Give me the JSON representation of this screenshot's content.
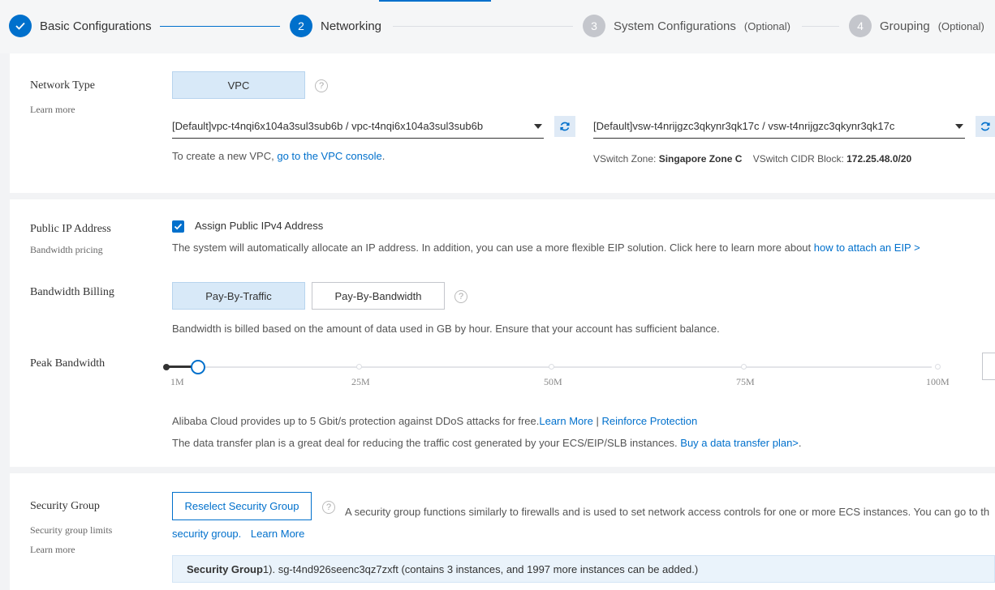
{
  "steps": [
    {
      "title": "Basic Configurations",
      "status": "done",
      "optional": ""
    },
    {
      "number": "2",
      "title": "Networking",
      "status": "active",
      "optional": ""
    },
    {
      "number": "3",
      "title": "System Configurations",
      "status": "todo",
      "optional": "(Optional)"
    },
    {
      "number": "4",
      "title": "Grouping",
      "status": "todo",
      "optional": "(Optional)"
    }
  ],
  "network": {
    "label": "Network Type",
    "learn_more": "Learn more",
    "type_button": "VPC",
    "vpc_value": "[Default]vpc-t4nqi6x104a3sul3sub6b / vpc-t4nqi6x104a3sul3sub6b",
    "vswitch_value": "[Default]vsw-t4nrijgzc3qkynr3qk17c / vsw-t4nrijgzc3qkynr3qk17c",
    "vpc_hint_prefix": "To create a new VPC, ",
    "vpc_hint_link": "go to the VPC console",
    "vpc_hint_suffix": ".",
    "zone_label": "VSwitch Zone:",
    "zone_value": "Singapore Zone C",
    "cidr_label": "VSwitch CIDR Block:",
    "cidr_value": "172.25.48.0/20"
  },
  "public_ip": {
    "label": "Public IP Address",
    "sublabel": "Bandwidth pricing",
    "checkbox_label": "Assign Public IPv4 Address",
    "checked": true,
    "desc_prefix": "The system will automatically allocate an IP address. In addition, you can use a more flexible EIP solution. Click here to learn more about ",
    "desc_link": "how to attach an EIP >"
  },
  "billing": {
    "label": "Bandwidth Billing",
    "options": [
      "Pay-By-Traffic",
      "Pay-By-Bandwidth"
    ],
    "selected": "Pay-By-Traffic",
    "desc": "Bandwidth is billed based on the amount of data used in GB by hour. Ensure that your account has sufficient balance."
  },
  "peak": {
    "label": "Peak Bandwidth",
    "value_mbps": 5,
    "ticks": [
      "1M",
      "25M",
      "50M",
      "75M",
      "100M"
    ],
    "ddos_prefix": "Alibaba Cloud provides up to 5 Gbit/s protection against DDoS attacks for free.",
    "ddos_link1": "Learn More",
    "ddos_sep": " | ",
    "ddos_link2": "Reinforce Protection",
    "plan_prefix": "The data transfer plan is a great deal for reducing the traffic cost generated by your ECS/EIP/SLB instances. ",
    "plan_link": "Buy a data transfer plan>",
    "plan_suffix": "."
  },
  "security": {
    "label": "Security Group",
    "sublabel1": "Security group limits",
    "sublabel2": "Learn more",
    "button": "Reselect Security Group",
    "desc": "A security group functions similarly to firewalls and is used to set network access controls for one or more ECS instances. You can go to th",
    "link1": "security group.",
    "link2": "Learn More",
    "group_label": "Security Group",
    "group_text": " 1). sg-t4nd926seenc3qz7zxft (contains 3 instances, and 1997 more instances can be added.)"
  },
  "colors": {
    "accent": "#0070cc",
    "selected_bg": "#d8e9f8",
    "page_bg": "#f2f3f5"
  }
}
